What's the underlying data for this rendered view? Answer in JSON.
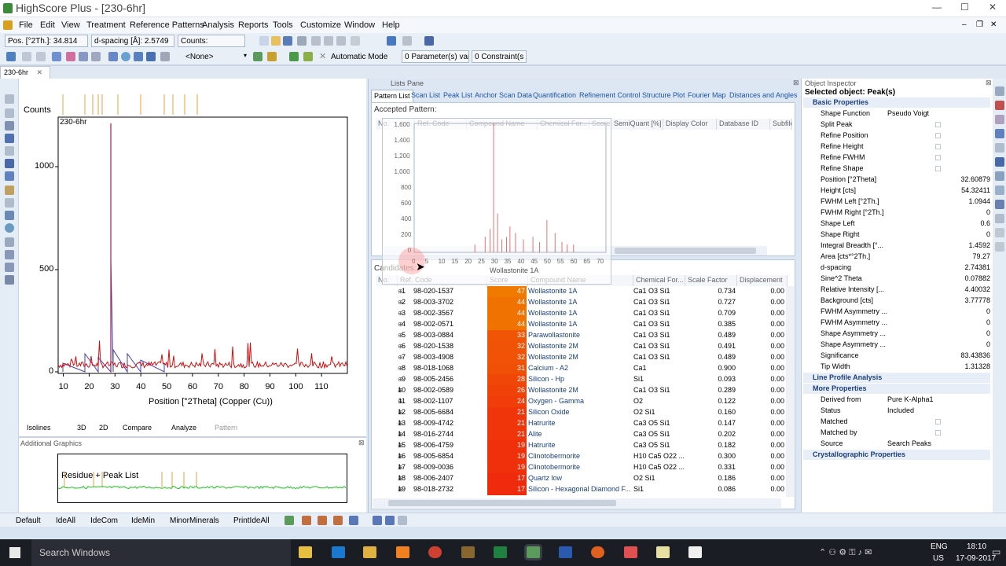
{
  "app": {
    "title": "HighScore Plus - [230-6hr]",
    "doc_tab": "230-6hr"
  },
  "menu": [
    "File",
    "Edit",
    "View",
    "Treatment",
    "Reference Patterns",
    "Analysis",
    "Reports",
    "Tools",
    "Customize",
    "Window",
    "Help"
  ],
  "toolbar": {
    "pos": "Pos. [°2Th.]: 34.814",
    "dspacing": "d-spacing [Å]: 2.5749",
    "counts": "Counts:",
    "none_select": "<None>",
    "auto_mode": "Automatic Mode",
    "params": "0 Parameter(s) var",
    "constraints": "0 Constraint(s"
  },
  "plot": {
    "ylabel": "Counts",
    "sample": "230-6hr",
    "yticks": [
      "1000",
      "500",
      "0"
    ],
    "xticks": [
      "10",
      "20",
      "30",
      "40",
      "50",
      "60",
      "70",
      "80",
      "90",
      "100",
      "110"
    ],
    "xlabel": "Position [°2Theta] (Copper (Cu))",
    "peak": {
      "x": 30.2,
      "y": 1150
    }
  },
  "view_tabs": [
    "Isolines",
    "3D",
    "2D",
    "Compare",
    "Analyze",
    "Pattern"
  ],
  "additional": {
    "title": "Additional Graphics",
    "label": "Residue + Peak List"
  },
  "lists": {
    "pane_title": "Lists Pane",
    "tabs": [
      "Pattern List",
      "Scan List",
      "Peak List",
      "Anchor Scan Data",
      "Quantification",
      "Refinement Control",
      "Structure Plot",
      "Fourier Map",
      "Distances and Angles"
    ],
    "accepted": "Accepted Pattern:",
    "candidates": "Candidates:",
    "pattern_cols": [
      "No.",
      "Ref. Code",
      "Compound Name",
      "Chemical For...",
      "Score",
      "SemiQuant [%]",
      "Display Color",
      "Database ID",
      "Subfile"
    ],
    "cand_cols": [
      "No.",
      "Ref. Code",
      "Score",
      "Compound Name",
      "Chemical For...",
      "Scale Factor",
      "Displacement"
    ],
    "popup": {
      "label": "Wollastonite 1A",
      "yticks": [
        "1,600",
        "1,400",
        "1,200",
        "1,000",
        "800",
        "600",
        "400",
        "200",
        "0"
      ],
      "xticks": [
        "0",
        "5",
        "10",
        "15",
        "20",
        "25",
        "30",
        "35",
        "40",
        "45",
        "50",
        "55",
        "60",
        "65",
        "70"
      ]
    },
    "rows": [
      [
        "1",
        "98-020-1537",
        "47",
        "Wollastonite 1A",
        "Ca1 O3 Si1",
        "0.734",
        "0.00"
      ],
      [
        "2",
        "98-003-3702",
        "44",
        "Wollastonite 1A",
        "Ca1 O3 Si1",
        "0.727",
        "0.00"
      ],
      [
        "3",
        "98-002-3567",
        "44",
        "Wollastonite 1A",
        "Ca1 O3 Si1",
        "0.709",
        "0.00"
      ],
      [
        "4",
        "98-002-0571",
        "44",
        "Wollastonite 1A",
        "Ca1 O3 Si1",
        "0.385",
        "0.00"
      ],
      [
        "5",
        "98-003-0884",
        "33",
        "Parawollastonite",
        "Ca1 O3 Si1",
        "0.489",
        "0.00"
      ],
      [
        "6",
        "98-020-1538",
        "32",
        "Wollastonite 2M",
        "Ca1 O3 Si1",
        "0.491",
        "0.00"
      ],
      [
        "7",
        "98-003-4908",
        "32",
        "Wollastonite 2M",
        "Ca1 O3 Si1",
        "0.489",
        "0.00"
      ],
      [
        "8",
        "98-018-1068",
        "31",
        "Calcium - A2",
        "Ca1",
        "0.900",
        "0.00"
      ],
      [
        "9",
        "98-005-2456",
        "28",
        "Silicon - Hp",
        "Si1",
        "0.093",
        "0.00"
      ],
      [
        "10",
        "98-002-0589",
        "26",
        "Wollastonite 2M",
        "Ca1 O3 Si1",
        "0.289",
        "0.00"
      ],
      [
        "11",
        "98-002-1107",
        "24",
        "Oxygen - Gamma",
        "O2",
        "0.122",
        "0.00"
      ],
      [
        "12",
        "98-005-6684",
        "21",
        "Silicon Oxide",
        "O2 Si1",
        "0.160",
        "0.00"
      ],
      [
        "13",
        "98-009-4742",
        "21",
        "Hatrurite",
        "Ca3 O5 Si1",
        "0.147",
        "0.00"
      ],
      [
        "14",
        "98-016-2744",
        "21",
        "Alite",
        "Ca3 O5 Si1",
        "0.202",
        "0.00"
      ],
      [
        "15",
        "98-006-4759",
        "19",
        "Hatrurite",
        "Ca3 O5 Si1",
        "0.182",
        "0.00"
      ],
      [
        "16",
        "98-005-6854",
        "19",
        "Clinotobermorite",
        "H10 Ca5 O22 ...",
        "0.300",
        "0.00"
      ],
      [
        "17",
        "98-009-0036",
        "19",
        "Clinotobermorite",
        "H10 Ca5 O22 ...",
        "0.331",
        "0.00"
      ],
      [
        "18",
        "98-006-2407",
        "17",
        "Quartz low",
        "O2 Si1",
        "0.186",
        "0.00"
      ],
      [
        "19",
        "98-018-2732",
        "17",
        "Silicon - Hexagonal Diamond F...",
        "Si1",
        "0.086",
        "0.00"
      ]
    ]
  },
  "inspector": {
    "title": "Object Inspector",
    "selected": "Selected object: Peak(s)",
    "sections": [
      "Basic Properties",
      "Line Profile Analysis",
      "More Properties",
      "Crystallographic Properties"
    ],
    "basic": [
      [
        "Shape Function",
        "Pseudo Voigt"
      ],
      [
        "Split Peak",
        ""
      ],
      [
        "Refine Position",
        ""
      ],
      [
        "Refine Height",
        ""
      ],
      [
        "Refine FWHM",
        ""
      ],
      [
        "Refine Shape",
        ""
      ],
      [
        "Position [°2Theta]",
        "32.60879"
      ],
      [
        "Height [cts]",
        "54.32411"
      ],
      [
        "FWHM Left [°2Th.]",
        "1.0944"
      ],
      [
        "FWHM Right [°2Th.]",
        "0"
      ],
      [
        "Shape Left",
        "0.6"
      ],
      [
        "Shape Right",
        "0"
      ],
      [
        "Integral Breadth [°...",
        "1.4592"
      ],
      [
        "Area [cts*°2Th.]",
        "79.27"
      ],
      [
        "d-spacing",
        "2.74381"
      ],
      [
        "Sine^2 Theta",
        "0.07882"
      ],
      [
        "Relative Intensity [...",
        "4.40032"
      ],
      [
        "Background [cts]",
        "3.77778"
      ],
      [
        "FWHM Asymmetry ...",
        "0"
      ],
      [
        "FWHM Asymmetry ...",
        "0"
      ],
      [
        "Shape Asymmetry ...",
        "0"
      ],
      [
        "Shape Asymmetry ...",
        "0"
      ],
      [
        "Significance",
        "83.43836"
      ],
      [
        "Tip Width",
        "1.31328"
      ]
    ],
    "more": [
      [
        "Derived from",
        "Pure K-Alpha1"
      ],
      [
        "Status",
        "Included"
      ],
      [
        "Matched",
        ""
      ],
      [
        "Matched by",
        ""
      ],
      [
        "Source",
        "Search Peaks"
      ]
    ]
  },
  "status": [
    "Default",
    "IdeAll",
    "IdeCom",
    "IdeMin",
    "MinorMinerals",
    "PrintIdeAll"
  ],
  "taskbar": {
    "search": "Search Windows",
    "lang1": "ENG",
    "lang2": "US",
    "time": "18:10",
    "date": "17-09-2017"
  },
  "colors": {
    "accent": "#1b54a8",
    "score_hi": "#f07a00",
    "score_lo": "#e8300c",
    "scan": "#d01010",
    "ref": "#4a3ab0",
    "bg_peaks": "#f0a040"
  }
}
